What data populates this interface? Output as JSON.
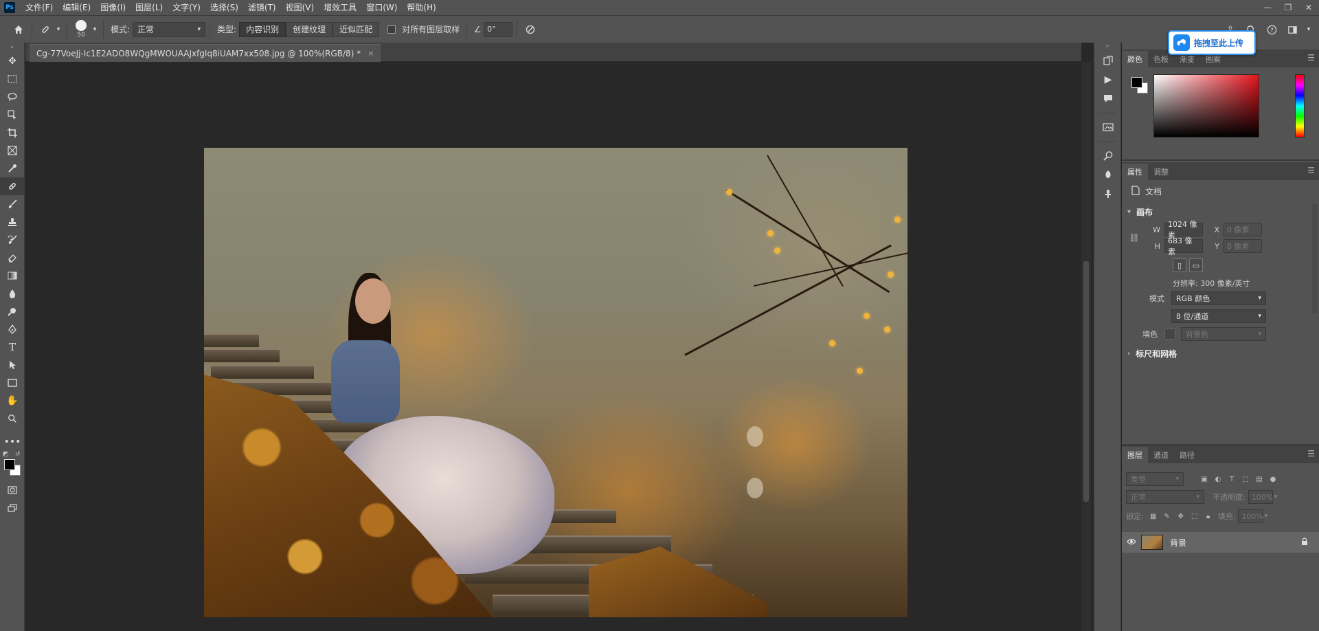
{
  "app": {
    "logo_text": "Ps",
    "menu": [
      "文件(F)",
      "编辑(E)",
      "图像(I)",
      "图层(L)",
      "文字(Y)",
      "选择(S)",
      "滤镜(T)",
      "视图(V)",
      "增效工具",
      "窗口(W)",
      "帮助(H)"
    ],
    "window_controls": {
      "minimize": "—",
      "restore": "❐",
      "close": "✕"
    }
  },
  "options": {
    "brush_size": "50",
    "mode_label": "模式:",
    "mode_value": "正常",
    "type_label": "类型:",
    "type_buttons": [
      "内容识别",
      "创建纹理",
      "近似匹配"
    ],
    "sample_all_label": "对所有图层取样",
    "angle_value": "0°"
  },
  "upload": {
    "label": "拖拽至此上传"
  },
  "document": {
    "tab_title": "Cg-77VoeJj-Ic1E2ADO8WQgMWOUAAJxfgIq8iUAM7xx508.jpg @ 100%(RGB/8) *",
    "tab_close": "×"
  },
  "color_panel": {
    "tabs": [
      "颜色",
      "色板",
      "渐变",
      "图案"
    ]
  },
  "properties_panel": {
    "tabs": [
      "属性",
      "调整"
    ],
    "doc_label": "文档",
    "canvas_section": "画布",
    "w_label": "W",
    "w_value": "1024 像素",
    "h_label": "H",
    "h_value": "683 像素",
    "x_label": "X",
    "x_placeholder": "0 像素",
    "y_label": "Y",
    "y_placeholder": "0 像素",
    "resolution": "分辨率: 300 像素/英寸",
    "mode_label": "模式",
    "mode_value": "RGB 颜色",
    "depth_value": "8 位/通道",
    "fill_label": "填色",
    "fill_value": "背景色",
    "rulers_section": "标尺和网格"
  },
  "layers_panel": {
    "tabs": [
      "图层",
      "通道",
      "路径"
    ],
    "search_placeholder": "类型",
    "blend_mode": "正常",
    "opacity_label": "不透明度:",
    "opacity_value": "100%",
    "lock_label": "锁定:",
    "fill_label": "填充:",
    "fill_value": "100%",
    "layers": [
      {
        "name": "背景",
        "visible": true,
        "locked": true
      }
    ]
  }
}
